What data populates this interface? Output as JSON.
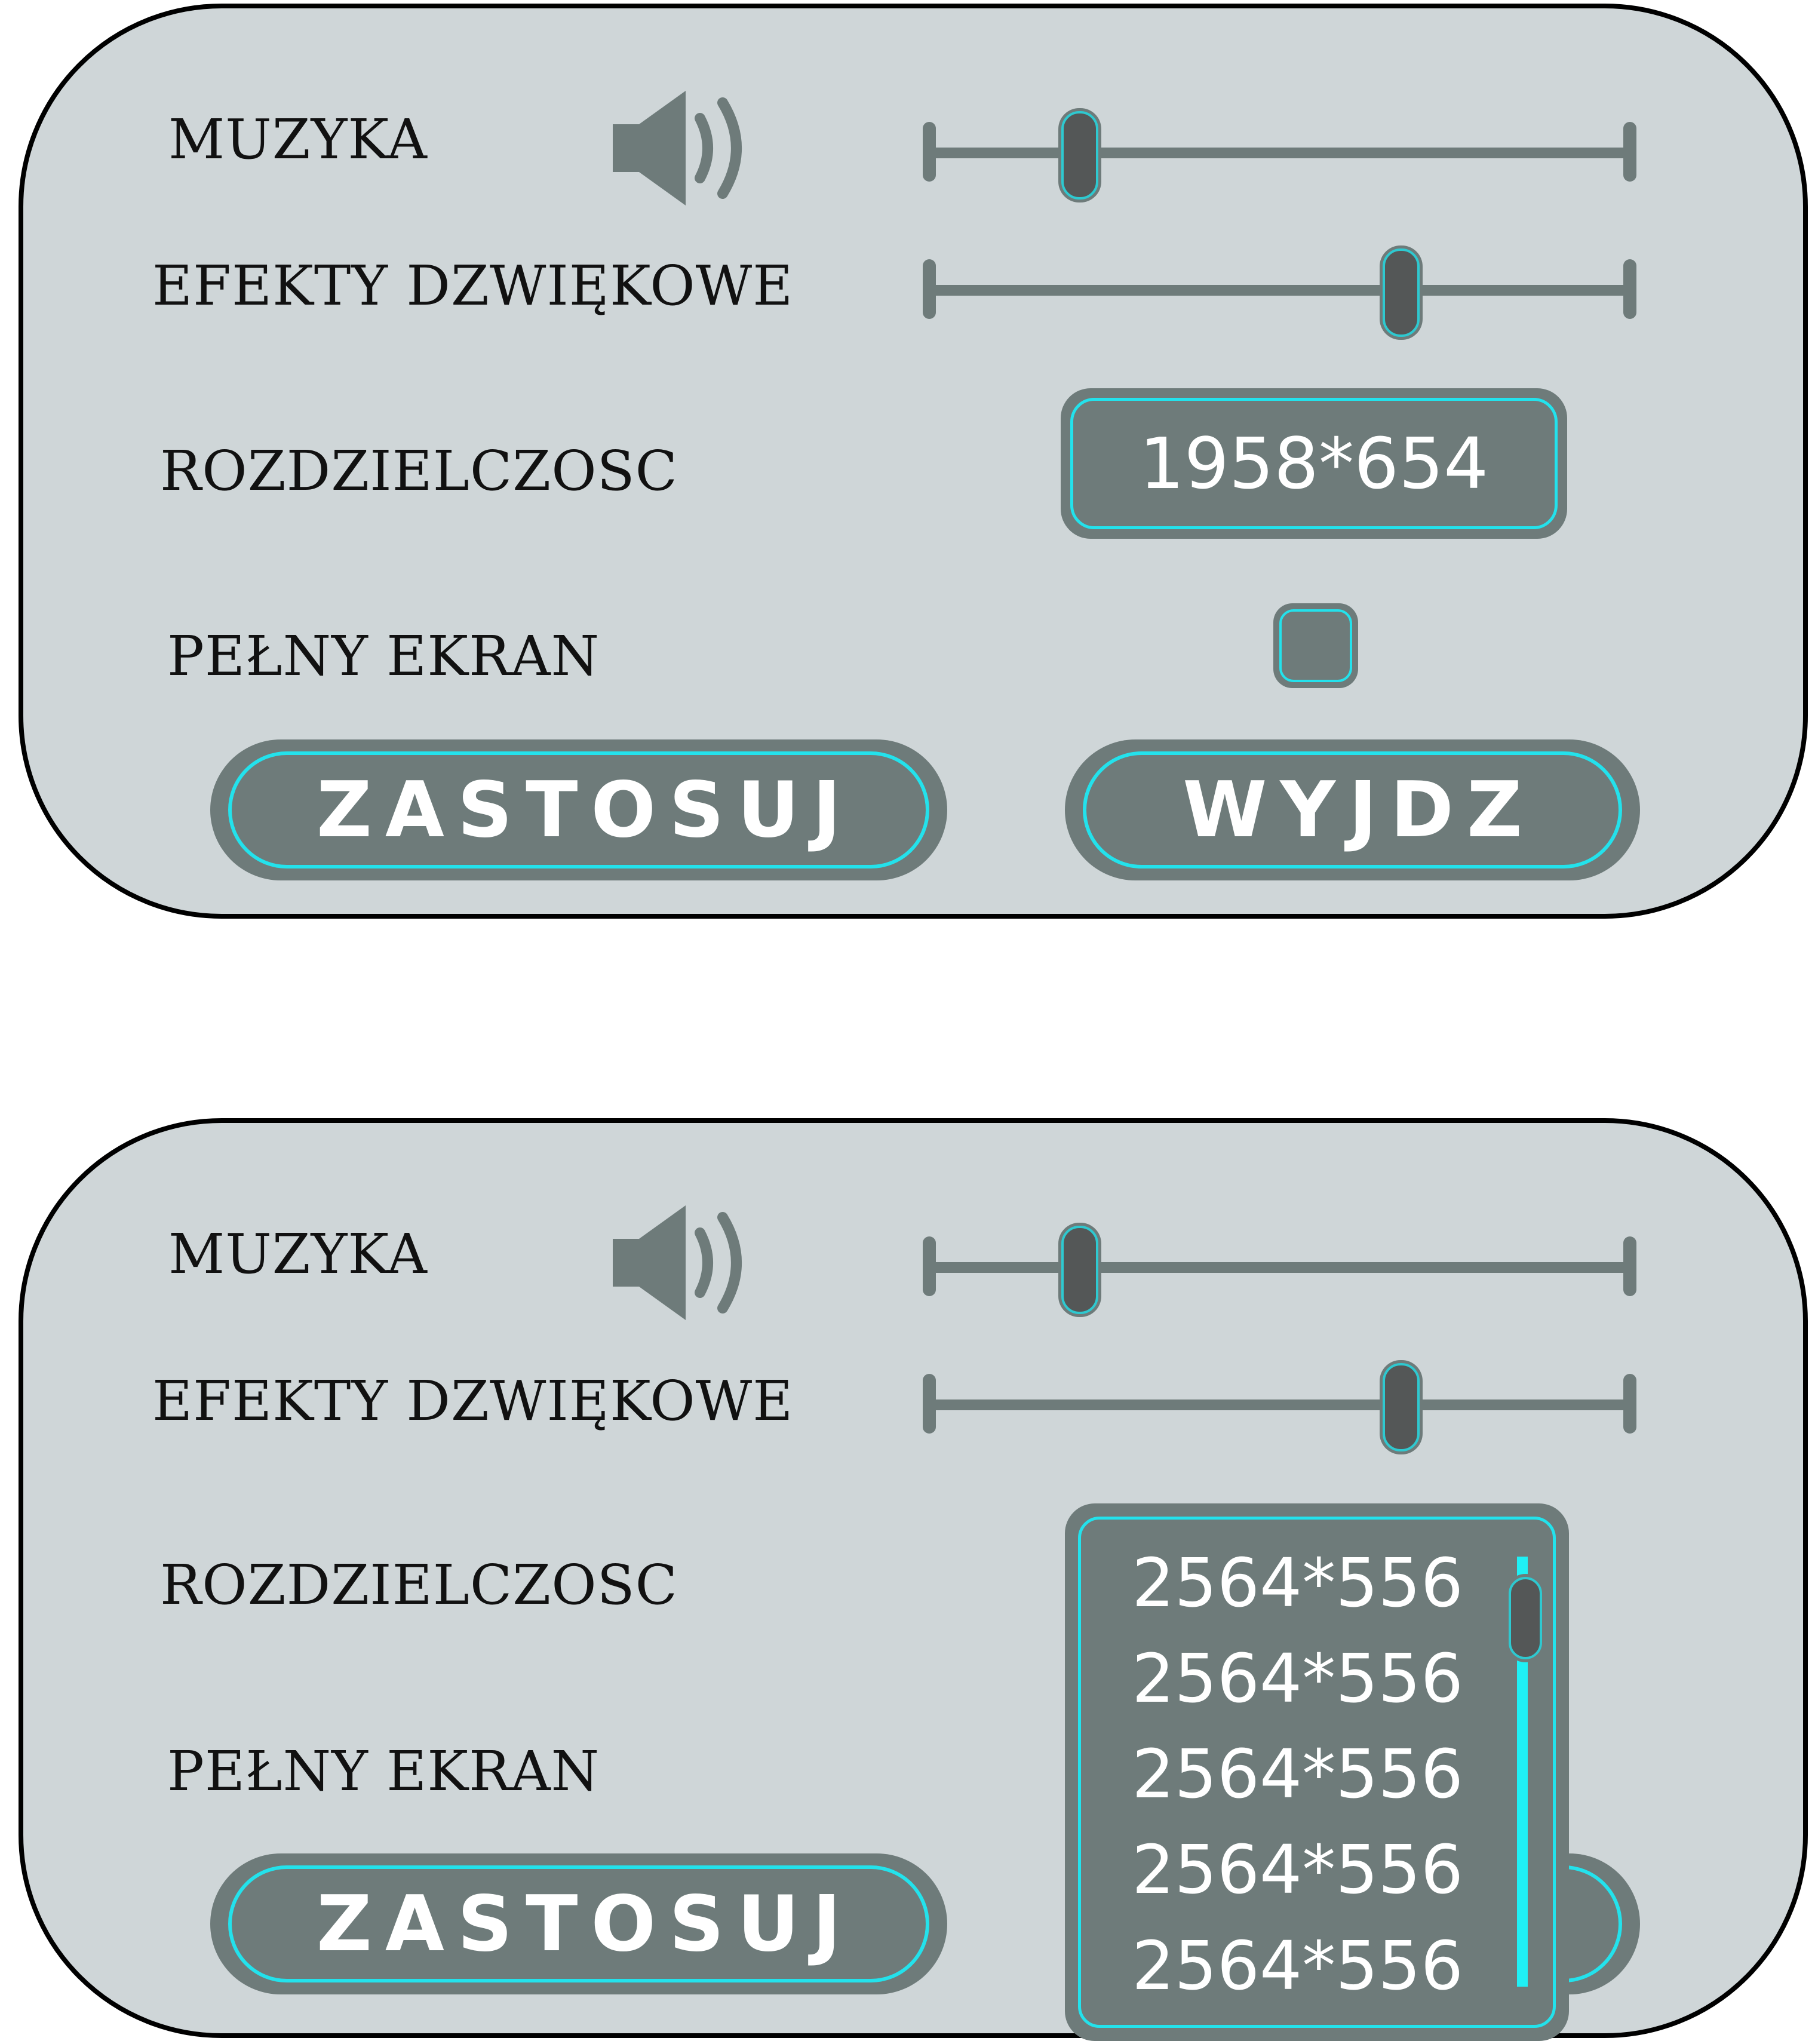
{
  "colors": {
    "panel_bg": "#cfd6d8",
    "control_fill": "#6e7b7a",
    "accent_cyan": "#23e2ec",
    "thumb_fill": "#545757",
    "text": "#111111",
    "text_light": "#ffffff"
  },
  "settings_top": {
    "music_label": "MUZYKA",
    "music_icon": "speaker-volume-icon",
    "music_level": 0.22,
    "effects_label": "EFEKTY DZWIĘKOWE",
    "effects_level": 0.67,
    "resolution_label": "ROZDZIELCZOSC",
    "resolution_value": "1958*654",
    "fullscreen_label": "PEŁNY EKRAN",
    "fullscreen_checked": false,
    "apply_label": "ZASTOSUJ",
    "exit_label": "WYJDZ"
  },
  "settings_bottom": {
    "music_label": "MUZYKA",
    "music_icon": "speaker-volume-icon",
    "music_level": 0.22,
    "effects_label": "EFEKTY DZWIĘKOWE",
    "effects_level": 0.67,
    "resolution_label": "ROZDZIELCZOSC",
    "fullscreen_label": "PEŁNY EKRAN",
    "apply_label": "ZASTOSUJ",
    "resolution_options": [
      "2564*556",
      "2564*556",
      "2564*556",
      "2564*556",
      "2564*556"
    ]
  }
}
